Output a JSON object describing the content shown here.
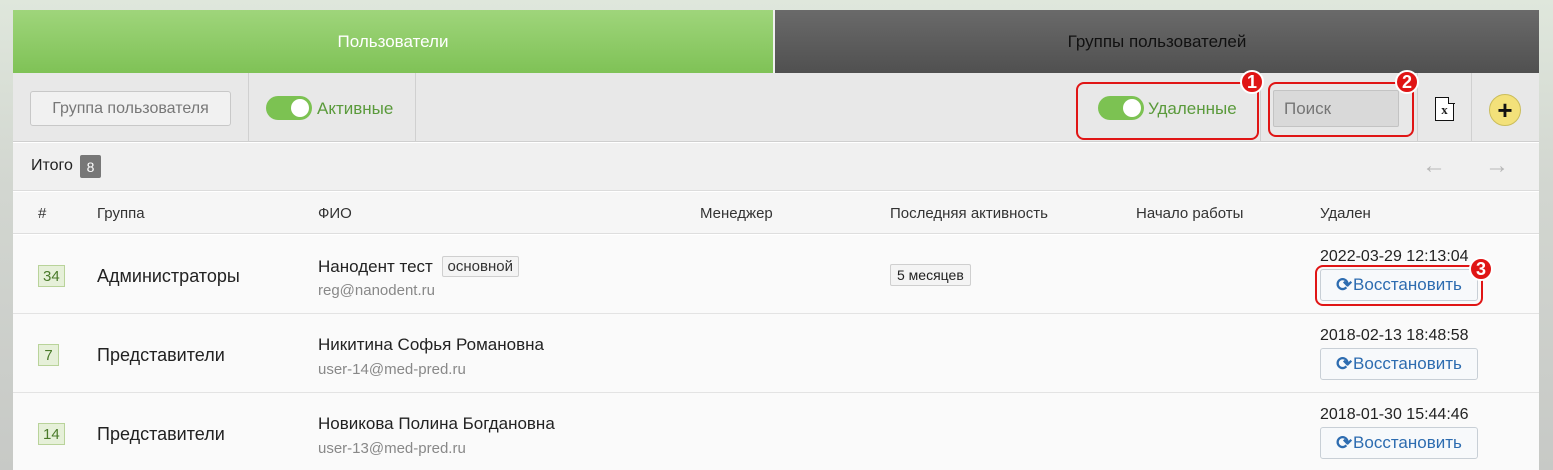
{
  "tabs": {
    "users": "Пользователи",
    "groups": "Группы пользователей"
  },
  "toolbar": {
    "group_button": "Группа пользователя",
    "active_label": "Активные",
    "deleted_label": "Удаленные",
    "search_placeholder": "Поиск",
    "excel_icon": "x",
    "add_icon": "+",
    "markers": [
      "1",
      "2",
      "3"
    ]
  },
  "summary": {
    "total_label": "Итого",
    "total_count": "8",
    "prev_arrow": "←",
    "next_arrow": "→"
  },
  "table": {
    "headers": [
      "#",
      "Группа",
      "ФИО",
      "Менеджер",
      "Последняя активность",
      "Начало работы",
      "Удален"
    ],
    "rows": [
      {
        "id": "34",
        "group": "Администраторы",
        "name": "Нанодент тест",
        "tag": "основной",
        "email": "reg@nanodent.ru",
        "activity": "5 месяцев",
        "deleted": "2022-03-29 12:13:04",
        "restore": "Восстановить"
      },
      {
        "id": "7",
        "group": "Представители",
        "name": "Никитина Софья Романовна",
        "email": "user-14@med-pred.ru",
        "deleted": "2018-02-13 18:48:58",
        "restore": "Восстановить"
      },
      {
        "id": "14",
        "group": "Представители",
        "name": "Новикова Полина Богдановна",
        "email": "user-13@med-pred.ru",
        "deleted": "2018-01-30 15:44:46",
        "restore": "Восстановить"
      }
    ]
  },
  "colors": {
    "accent_green": "#7fc256",
    "annotation_red": "#e01515",
    "link_blue": "#2d6cb0"
  }
}
